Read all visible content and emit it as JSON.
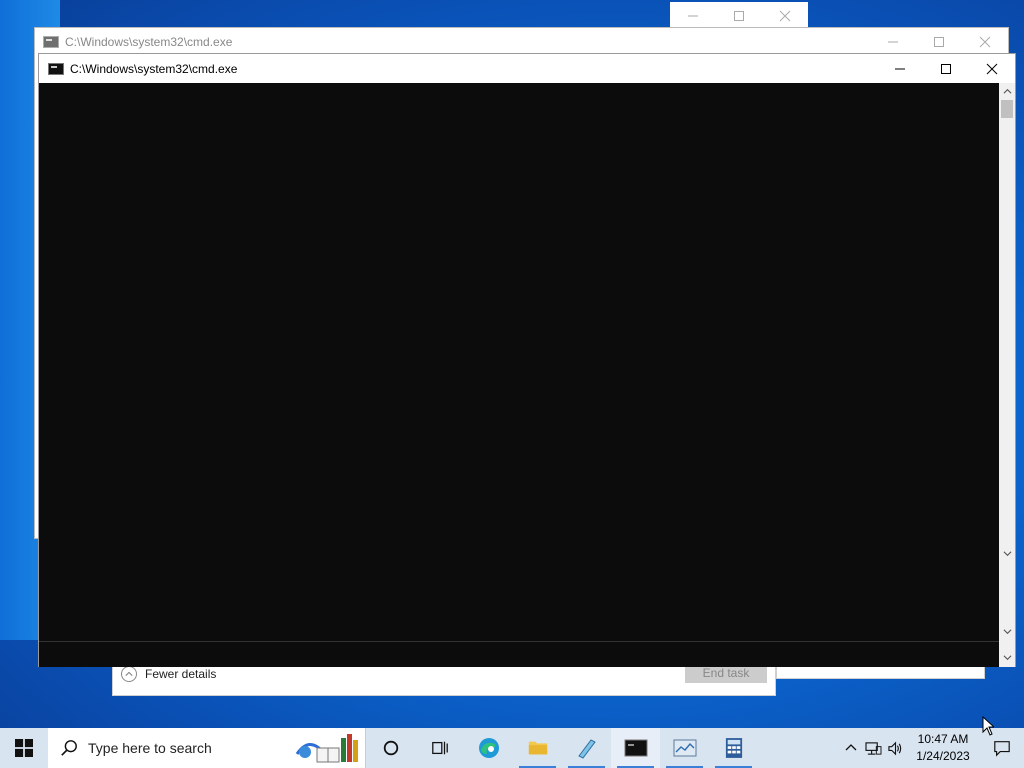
{
  "desktop": {
    "background_color": "#0b66cf"
  },
  "task_manager": {
    "fewer_details_label": "Fewer details",
    "end_task_label": "End task"
  },
  "cmd_back": {
    "title": "C:\\Windows\\system32\\cmd.exe"
  },
  "cmd_front": {
    "title": "C:\\Windows\\system32\\cmd.exe",
    "console_background": "#0c0c0c"
  },
  "taskbar": {
    "search_placeholder": "Type here to search",
    "apps": [
      {
        "name": "task-view-icon"
      },
      {
        "name": "edge-icon"
      },
      {
        "name": "file-explorer-icon"
      },
      {
        "name": "notepad-icon"
      },
      {
        "name": "command-prompt-icon"
      },
      {
        "name": "task-manager-icon"
      },
      {
        "name": "calculator-icon"
      }
    ],
    "clock_time": "10:47 AM",
    "clock_date": "1/24/2023"
  }
}
